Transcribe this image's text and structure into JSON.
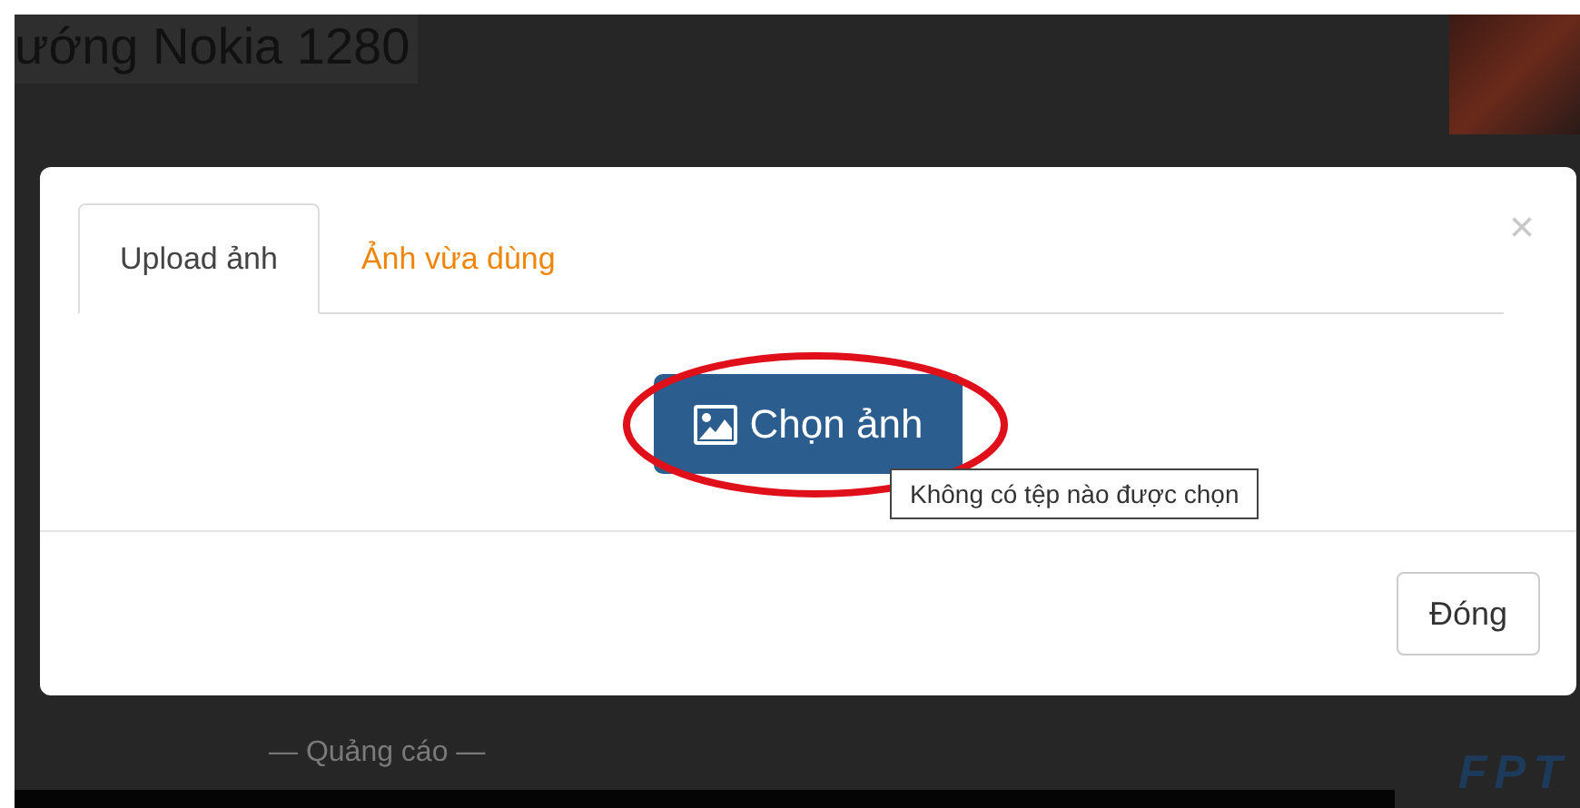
{
  "page": {
    "heading": "ướng Nokia 1280",
    "ad_label": "— Quảng cáo —",
    "ad_logo": "FPT"
  },
  "modal": {
    "tabs": [
      {
        "label": "Upload ảnh",
        "selected": true
      },
      {
        "label": "Ảnh vừa dùng",
        "selected": false
      }
    ],
    "close": "×",
    "choose_button": "Chọn ảnh",
    "tooltip": "Không có tệp nào được chọn",
    "close_button": "Đóng"
  }
}
